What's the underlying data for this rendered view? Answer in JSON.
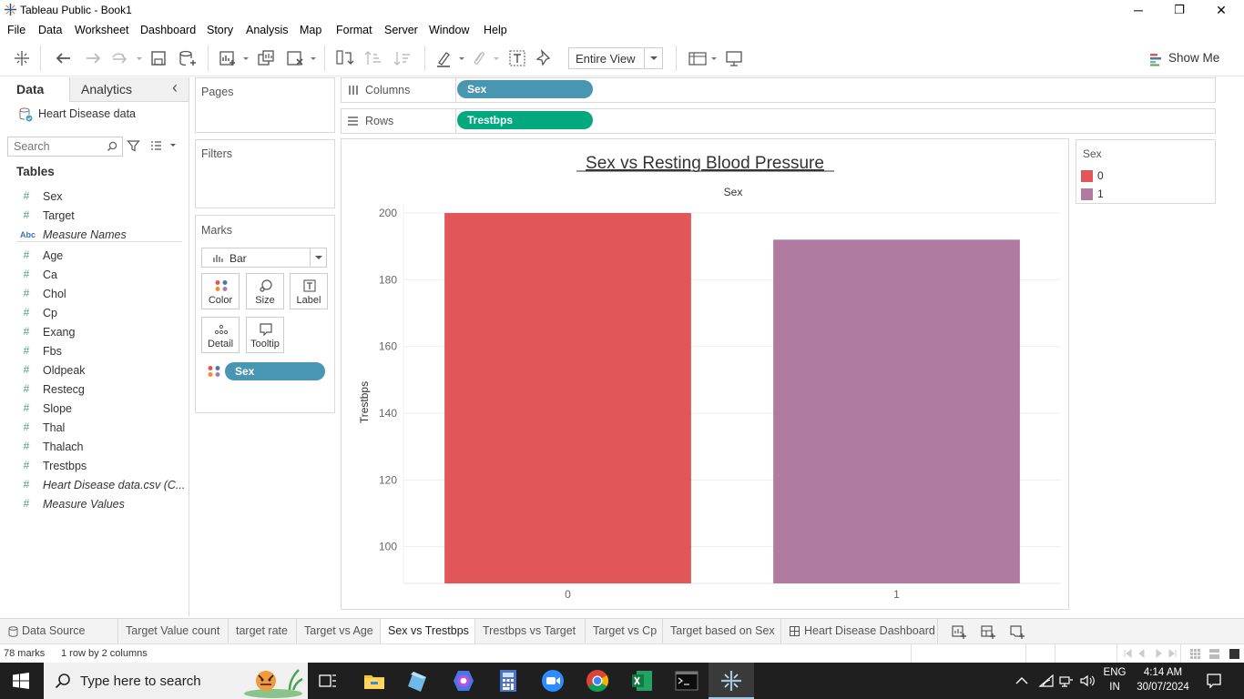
{
  "window": {
    "title": "Tableau Public - Book1",
    "controls": [
      "─",
      "❐",
      "✕"
    ]
  },
  "menu": [
    "File",
    "Data",
    "Worksheet",
    "Dashboard",
    "Story",
    "Analysis",
    "Map",
    "Format",
    "Server",
    "Window",
    "Help"
  ],
  "toolbar": {
    "fit_label": "Entire View",
    "show_me_label": "Show Me"
  },
  "datapane": {
    "tab_data": "Data",
    "tab_analytics": "Analytics",
    "collapse_glyph": "‹",
    "datasource": "Heart Disease data",
    "search_placeholder": "Search",
    "tables_heading": "Tables",
    "fields": [
      {
        "icon": "#",
        "name": "Sex",
        "italic": false
      },
      {
        "icon": "#",
        "name": "Target",
        "italic": false
      },
      {
        "icon": "Abc",
        "name": "Measure Names",
        "italic": true
      },
      {
        "icon": "#",
        "name": "Age",
        "italic": false
      },
      {
        "icon": "#",
        "name": "Ca",
        "italic": false
      },
      {
        "icon": "#",
        "name": "Chol",
        "italic": false
      },
      {
        "icon": "#",
        "name": "Cp",
        "italic": false
      },
      {
        "icon": "#",
        "name": "Exang",
        "italic": false
      },
      {
        "icon": "#",
        "name": "Fbs",
        "italic": false
      },
      {
        "icon": "#",
        "name": "Oldpeak",
        "italic": false
      },
      {
        "icon": "#",
        "name": "Restecg",
        "italic": false
      },
      {
        "icon": "#",
        "name": "Slope",
        "italic": false
      },
      {
        "icon": "#",
        "name": "Thal",
        "italic": false
      },
      {
        "icon": "#",
        "name": "Thalach",
        "italic": false
      },
      {
        "icon": "#",
        "name": "Trestbps",
        "italic": false
      },
      {
        "icon": "#",
        "name": "Heart Disease data.csv (C...",
        "italic": true
      },
      {
        "icon": "#",
        "name": "Measure Values",
        "italic": true
      }
    ]
  },
  "cards": {
    "pages": "Pages",
    "filters": "Filters",
    "marks": "Marks",
    "mark_type": "Bar",
    "mark_buttons": [
      "Color",
      "Size",
      "Label",
      "Detail",
      "Tooltip"
    ],
    "color_pill": "Sex"
  },
  "shelves": {
    "columns_label": "Columns",
    "columns_pill": "Sex",
    "rows_label": "Rows",
    "rows_pill": "Trestbps"
  },
  "colors": {
    "pill_dimension": "#4996b2",
    "pill_measure": "#02a87e",
    "bar_0": "#e15759",
    "bar_1": "#b07aa1"
  },
  "chart_data": {
    "type": "bar",
    "title": "Sex vs Resting Blood Pressure",
    "xlabel": "Sex",
    "ylabel": "Trestbps",
    "categories": [
      "0",
      "1"
    ],
    "values": [
      200,
      192
    ],
    "colors": [
      "#e15759",
      "#b07aa1"
    ],
    "ylim": [
      89,
      203
    ],
    "yticks": [
      100,
      120,
      140,
      160,
      180,
      200
    ],
    "grid": true,
    "legend_position": "right"
  },
  "legend": {
    "title": "Sex",
    "items": [
      {
        "label": "0",
        "color": "#e15759"
      },
      {
        "label": "1",
        "color": "#b07aa1"
      }
    ]
  },
  "sheet_tabs": [
    {
      "label": "Data Source",
      "active": false
    },
    {
      "label": "Target Value count",
      "active": false
    },
    {
      "label": "target rate",
      "active": false
    },
    {
      "label": "Target vs Age",
      "active": false
    },
    {
      "label": "Sex vs Trestbps",
      "active": true
    },
    {
      "label": "Trestbps vs Target",
      "active": false
    },
    {
      "label": "Target vs Cp",
      "active": false
    },
    {
      "label": "Target based on Sex",
      "active": false
    },
    {
      "label": "Heart Disease Dashboard",
      "active": false
    }
  ],
  "status": {
    "marks": "78 marks",
    "layout": "1 row by 2 columns"
  },
  "taskbar": {
    "search_placeholder": "Type here to search",
    "lang_top": "ENG",
    "lang_bottom": "IN",
    "time": "4:14 AM",
    "date": "30/07/2024"
  }
}
